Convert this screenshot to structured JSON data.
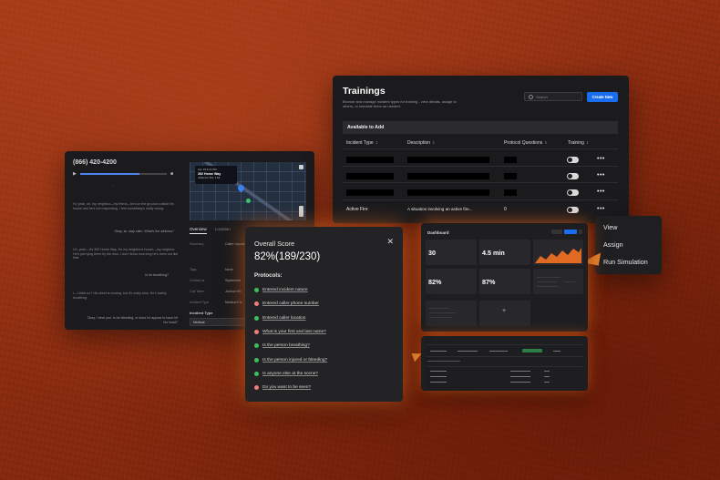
{
  "call": {
    "phone": "(866) 420-4200",
    "map": {
      "card_line1": "Apr 19 9:11 PM",
      "address": "392 Home Way",
      "card_line3": "Jefferson Rd, 1 Mi"
    },
    "tabs": [
      "Overview",
      "Location"
    ],
    "fields": [
      {
        "label": "Summary",
        "value": "Caller reports..."
      },
      {
        "label": "Tags",
        "value": "None"
      },
      {
        "label": "Contact at",
        "value": "September"
      },
      {
        "label": "Call Taker",
        "value": "Joshua Wil"
      },
      {
        "label": "Incident Type",
        "value": "Medical Em"
      }
    ],
    "incident_type_label": "Incident Type",
    "incident_type_value": "Medical",
    "messages": [
      {
        "side": "left",
        "text": "Hi, yeah, uh, my neighbor—my friend—he's on the ground outside his house and he's not responding. I feel something's really wrong."
      },
      {
        "side": "right",
        "text": "Okay, sir, stay calm. What's the address?"
      },
      {
        "side": "right",
        "text": "Is he breathing?"
      },
      {
        "side": "left",
        "text": "Uh, yeah—it's 392 Home Way. It's my neighbor's house—my neighbor. He's just lying there by the door. I don't know how long he's been out like that."
      },
      {
        "side": "left",
        "text": "I—I think so? His chest is moving, but it's really slow. He's barely breathing."
      },
      {
        "side": "right",
        "text": "Okay, I hear you. Is he bleeding, or does he appear to have hit his head?"
      }
    ]
  },
  "trainings": {
    "title": "Trainings",
    "description": "Browse and manage incident types for training - view details, assign to others, or simulate them as needed.",
    "search_placeholder": "Search",
    "create_label": "Create New",
    "section_label": "Available to Add",
    "columns": [
      "Incident Type",
      "Description",
      "Protocol Questions",
      "Training"
    ],
    "active_row": {
      "incident_type": "Active Fire",
      "description": "A situation involving an active fire...",
      "protocol_questions": "0"
    },
    "row_actions": "•••"
  },
  "menu": {
    "items": [
      "View",
      "Assign",
      "Run Simulation"
    ]
  },
  "score": {
    "title": "Overall Score",
    "value": "82%(189/230)",
    "protocols_label": "Protocols:",
    "close": "✕",
    "protocols": [
      {
        "text": "Entered incident nature",
        "status": "ok"
      },
      {
        "text": "Entered caller phone number",
        "status": "no"
      },
      {
        "text": "Entered caller location",
        "status": "ok"
      },
      {
        "text": "What is your first and last name?",
        "status": "no"
      },
      {
        "text": "Is the person breathing?",
        "status": "ok"
      },
      {
        "text": "Is the person injured or bleeding?",
        "status": "ok"
      },
      {
        "text": "Is anyone else at the scene?",
        "status": "ok"
      },
      {
        "text": "Do you want to be seen?",
        "status": "no"
      }
    ]
  },
  "dashboard": {
    "title": "Dashboard",
    "kpis": [
      {
        "value": "30"
      },
      {
        "value": "4.5 min"
      },
      {
        "value": "82%"
      },
      {
        "value": "87%"
      }
    ],
    "icon_caption": "+"
  },
  "colors": {
    "accent": "#1a6cf0",
    "success": "#3cbf5c",
    "fail": "#f07c7c",
    "glow": "#ff7a28"
  }
}
